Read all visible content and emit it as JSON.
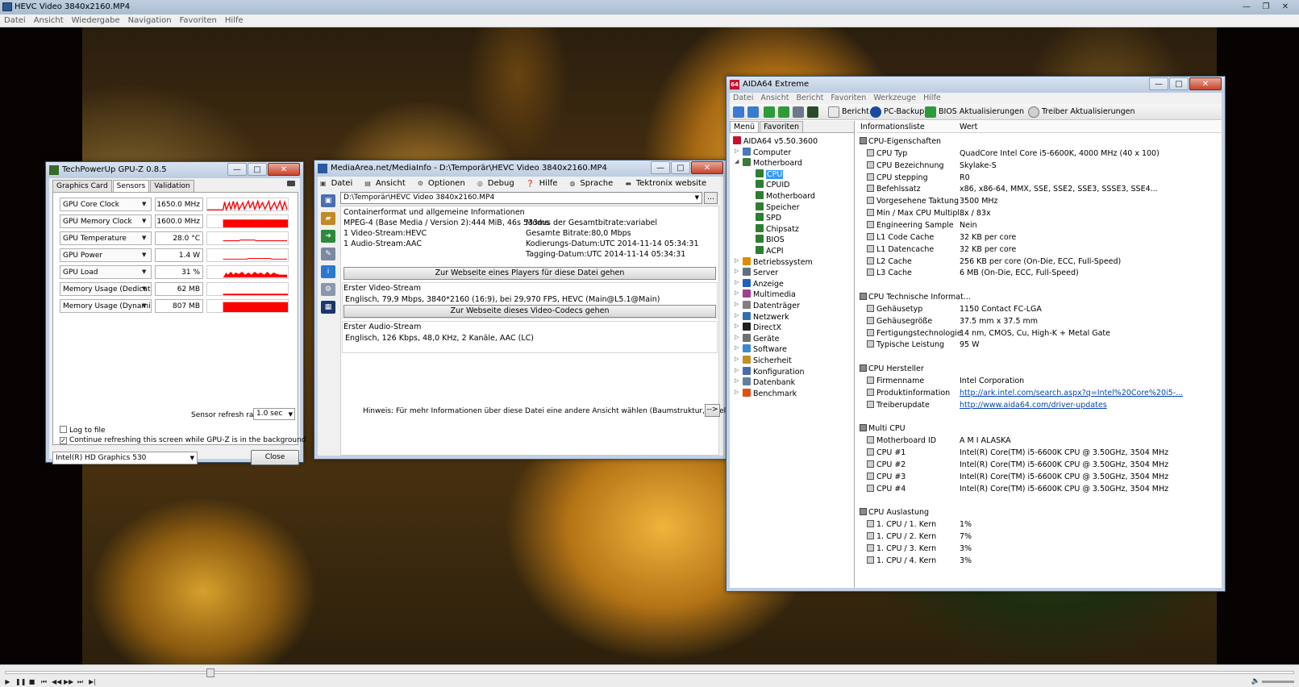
{
  "player": {
    "title": "HEVC Video 3840x2160.MP4",
    "menu": [
      "Datei",
      "Ansicht",
      "Wiedergabe",
      "Navigation",
      "Favoriten",
      "Hilfe"
    ],
    "seek_fraction": 0.157
  },
  "gpuz": {
    "title": "TechPowerUp GPU-Z 0.8.5",
    "tabs": [
      "Graphics Card",
      "Sensors",
      "Validation"
    ],
    "sensors": [
      {
        "label": "GPU Core Clock",
        "value": "1650.0 MHz"
      },
      {
        "label": "GPU Memory Clock",
        "value": "1600.0 MHz"
      },
      {
        "label": "GPU Temperature",
        "value": "28.0 °C"
      },
      {
        "label": "GPU Power",
        "value": "1.4 W"
      },
      {
        "label": "GPU Load",
        "value": "31 %"
      },
      {
        "label": "Memory Usage (Dedicated)",
        "value": "62 MB"
      },
      {
        "label": "Memory Usage (Dynamic)",
        "value": "807 MB"
      }
    ],
    "log_label": "Log to file",
    "continue_label": "Continue refreshing this screen while GPU-Z is in the background",
    "refresh_label": "Sensor refresh rate:",
    "refresh_value": "1.0 sec",
    "gpu_name": "Intel(R) HD Graphics 530",
    "close_label": "Close",
    "graph_color": "#ff0000"
  },
  "mediainfo": {
    "title": "MediaArea.net/MediaInfo - D:\\Temporär\\HEVC Video 3840x2160.MP4",
    "menu": [
      "Datei",
      "Ansicht",
      "Optionen",
      "Debug",
      "Hilfe",
      "Sprache",
      "Tektronix website"
    ],
    "file_path": "D:\\Temporär\\HEVC Video 3840x2160.MP4",
    "general_header": "Containerformat und allgemeine Informationen",
    "general_left": [
      "MPEG-4 (Base Media / Version 2):444 MiB, 46s 533ms",
      "1 Video-Stream:HEVC",
      "1 Audio-Stream:AAC"
    ],
    "general_right": [
      "Modus der Gesamtbitrate:variabel",
      "Gesamte Bitrate:80,0 Mbps",
      "Kodierungs-Datum:UTC 2014-11-14 05:34:31",
      "Tagging-Datum:UTC 2014-11-14 05:34:31"
    ],
    "player_button": "Zur Webseite eines Players für diese Datei gehen",
    "video_header": "Erster Video-Stream",
    "video_info": "Englisch, 79,9 Mbps, 3840*2160 (16:9), bei 29,970 FPS, HEVC (Main@L5.1@Main)",
    "codec_button": "Zur Webseite dieses Video-Codecs gehen",
    "audio_header": "Erster Audio-Stream",
    "audio_info": "Englisch, 126 Kbps, 48,0 KHz, 2 Kanäle, AAC (LC)",
    "hint": "Hinweis:  Für mehr Informationen über diese Datei eine andere Ansicht wählen (Baumstruktur, Tabelle...)",
    "more_button": "-->"
  },
  "aida": {
    "title": "AIDA64 Extreme",
    "menu": [
      "Datei",
      "Ansicht",
      "Bericht",
      "Favoriten",
      "Werkzeuge",
      "Hilfe"
    ],
    "toolbar": {
      "report": "Bericht",
      "backup": "PC-Backup",
      "bios": "BIOS Aktualisierungen",
      "drivers": "Treiber Aktualisierungen"
    },
    "left_tabs": [
      "Menü",
      "Favoriten"
    ],
    "tree": [
      {
        "label": "AIDA64 v5.50.3600",
        "level": 0,
        "color": "#c8102e"
      },
      {
        "label": "Computer",
        "level": 1,
        "color": "#4a78b8",
        "exp": "▷"
      },
      {
        "label": "Motherboard",
        "level": 1,
        "color": "#3a7a3a",
        "exp": "◢"
      },
      {
        "label": "CPU",
        "level": 2,
        "color": "#2e7d32",
        "selected": true
      },
      {
        "label": "CPUID",
        "level": 2,
        "color": "#2e7d32"
      },
      {
        "label": "Motherboard",
        "level": 2,
        "color": "#2e7d32"
      },
      {
        "label": "Speicher",
        "level": 2,
        "color": "#2e7d32"
      },
      {
        "label": "SPD",
        "level": 2,
        "color": "#2e7d32"
      },
      {
        "label": "Chipsatz",
        "level": 2,
        "color": "#2e7d32"
      },
      {
        "label": "BIOS",
        "level": 2,
        "color": "#2e7d32"
      },
      {
        "label": "ACPI",
        "level": 2,
        "color": "#2e7d32"
      },
      {
        "label": "Betriebssystem",
        "level": 1,
        "color": "#e08a00",
        "exp": "▷"
      },
      {
        "label": "Server",
        "level": 1,
        "color": "#607080",
        "exp": "▷"
      },
      {
        "label": "Anzeige",
        "level": 1,
        "color": "#2060c0",
        "exp": "▷"
      },
      {
        "label": "Multimedia",
        "level": 1,
        "color": "#a04090",
        "exp": "▷"
      },
      {
        "label": "Datenträger",
        "level": 1,
        "color": "#808080",
        "exp": "▷"
      },
      {
        "label": "Netzwerk",
        "level": 1,
        "color": "#3070b0",
        "exp": "▷"
      },
      {
        "label": "DirectX",
        "level": 1,
        "color": "#202020",
        "exp": "▷"
      },
      {
        "label": "Geräte",
        "level": 1,
        "color": "#707070",
        "exp": "▷"
      },
      {
        "label": "Software",
        "level": 1,
        "color": "#3a8ad0",
        "exp": "▷"
      },
      {
        "label": "Sicherheit",
        "level": 1,
        "color": "#c09020",
        "exp": "▷"
      },
      {
        "label": "Konfiguration",
        "level": 1,
        "color": "#4a6ab0",
        "exp": "▷"
      },
      {
        "label": "Datenbank",
        "level": 1,
        "color": "#6080a0",
        "exp": "▷"
      },
      {
        "label": "Benchmark",
        "level": 1,
        "color": "#e05010",
        "exp": "▷"
      }
    ],
    "list_header": {
      "field": "Informationsliste",
      "value": "Wert"
    },
    "sections": [
      {
        "title": "CPU-Eigenschaften",
        "rows": [
          {
            "field": "CPU Typ",
            "value": "QuadCore Intel Core i5-6600K, 4000 MHz (40 x 100)"
          },
          {
            "field": "CPU Bezeichnung",
            "value": "Skylake-S"
          },
          {
            "field": "CPU stepping",
            "value": "R0"
          },
          {
            "field": "Befehlssatz",
            "value": "x86, x86-64, MMX, SSE, SSE2, SSE3, SSSE3, SSE4..."
          },
          {
            "field": "Vorgesehene Taktung",
            "value": "3500 MHz"
          },
          {
            "field": "Min / Max CPU Multipl...",
            "value": "8x / 83x"
          },
          {
            "field": "Engineering Sample",
            "value": "Nein"
          },
          {
            "field": "L1 Code Cache",
            "value": "32 KB per core"
          },
          {
            "field": "L1 Datencache",
            "value": "32 KB per core"
          },
          {
            "field": "L2 Cache",
            "value": "256 KB per core  (On-Die, ECC, Full-Speed)"
          },
          {
            "field": "L3 Cache",
            "value": "6 MB  (On-Die, ECC, Full-Speed)"
          }
        ]
      },
      {
        "title": "CPU Technische Informat...",
        "rows": [
          {
            "field": "Gehäusetyp",
            "value": "1150 Contact FC-LGA"
          },
          {
            "field": "Gehäusegröße",
            "value": "37.5 mm x 37.5 mm"
          },
          {
            "field": "Fertigungstechnologie",
            "value": "14 nm, CMOS, Cu, High-K + Metal Gate"
          },
          {
            "field": "Typische Leistung",
            "value": "95 W"
          }
        ]
      },
      {
        "title": "CPU Hersteller",
        "rows": [
          {
            "field": "Firmenname",
            "value": "Intel Corporation"
          },
          {
            "field": "Produktinformation",
            "value": "http://ark.intel.com/search.aspx?q=Intel%20Core%20i5-...",
            "link": true
          },
          {
            "field": "Treiberupdate",
            "value": "http://www.aida64.com/driver-updates",
            "link": true
          }
        ]
      },
      {
        "title": "Multi CPU",
        "rows": [
          {
            "field": "Motherboard ID",
            "value": "A M I ALASKA"
          },
          {
            "field": "CPU #1",
            "value": "Intel(R) Core(TM) i5-6600K CPU @ 3.50GHz, 3504 MHz"
          },
          {
            "field": "CPU #2",
            "value": "Intel(R) Core(TM) i5-6600K CPU @ 3.50GHz, 3504 MHz"
          },
          {
            "field": "CPU #3",
            "value": "Intel(R) Core(TM) i5-6600K CPU @ 3.50GHz, 3504 MHz"
          },
          {
            "field": "CPU #4",
            "value": "Intel(R) Core(TM) i5-6600K CPU @ 3.50GHz, 3504 MHz"
          }
        ]
      },
      {
        "title": "CPU Auslastung",
        "rows": [
          {
            "field": "1. CPU / 1. Kern",
            "value": "1%"
          },
          {
            "field": "1. CPU / 2. Kern",
            "value": "7%"
          },
          {
            "field": "1. CPU / 3. Kern",
            "value": "3%"
          },
          {
            "field": "1. CPU / 4. Kern",
            "value": "3%"
          }
        ]
      }
    ]
  }
}
